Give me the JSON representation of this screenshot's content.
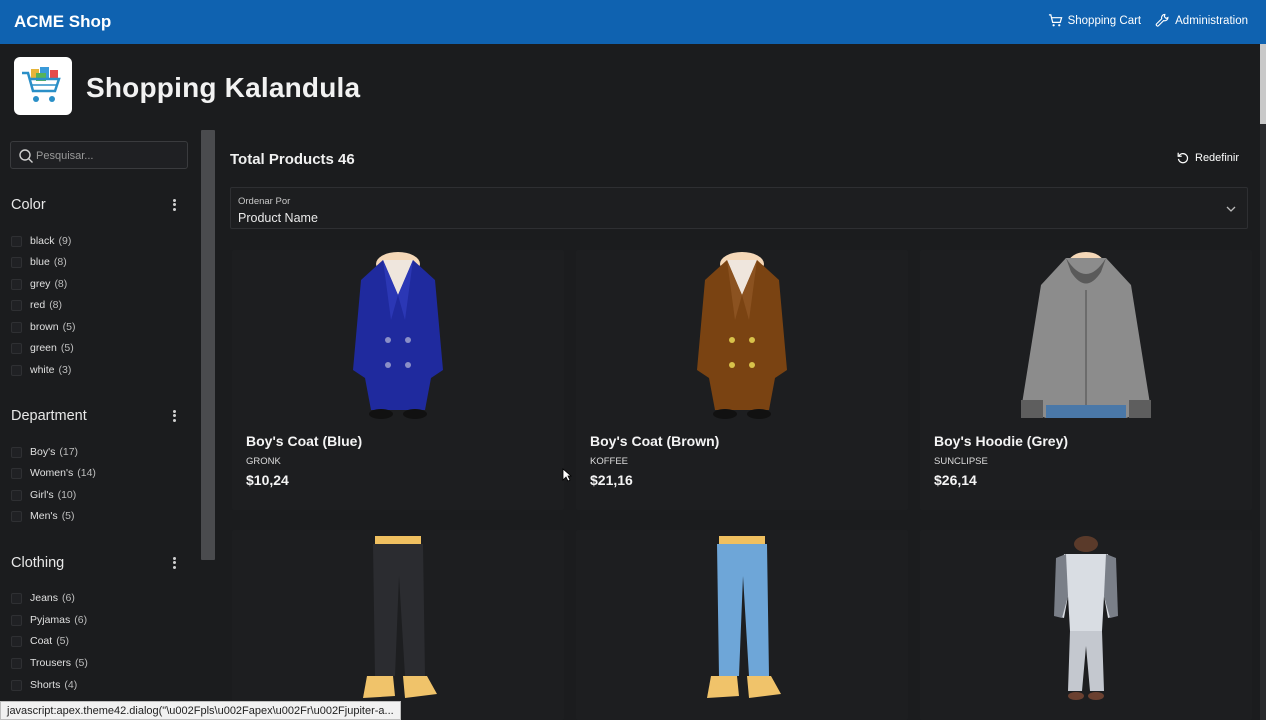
{
  "topbar": {
    "brand": "ACME Shop",
    "nav": [
      {
        "label": "Shopping Cart",
        "icon": "cart-icon"
      },
      {
        "label": "Administration",
        "icon": "wrench-icon"
      }
    ]
  },
  "header": {
    "title": "Shopping Kalandula",
    "logo_icon": "shopping-cart-logo-icon"
  },
  "sidebar": {
    "search_placeholder": "Pesquisar...",
    "facets": [
      {
        "title": "Color",
        "options": [
          {
            "label": "black",
            "count": "(9)"
          },
          {
            "label": "blue",
            "count": "(8)"
          },
          {
            "label": "grey",
            "count": "(8)"
          },
          {
            "label": "red",
            "count": "(8)"
          },
          {
            "label": "brown",
            "count": "(5)"
          },
          {
            "label": "green",
            "count": "(5)"
          },
          {
            "label": "white",
            "count": "(3)"
          }
        ]
      },
      {
        "title": "Department",
        "options": [
          {
            "label": "Boy's",
            "count": "(17)"
          },
          {
            "label": "Women's",
            "count": "(14)"
          },
          {
            "label": "Girl's",
            "count": "(10)"
          },
          {
            "label": "Men's",
            "count": "(5)"
          }
        ]
      },
      {
        "title": "Clothing",
        "options": [
          {
            "label": "Jeans",
            "count": "(6)"
          },
          {
            "label": "Pyjamas",
            "count": "(6)"
          },
          {
            "label": "Coat",
            "count": "(5)"
          },
          {
            "label": "Trousers",
            "count": "(5)"
          },
          {
            "label": "Shorts",
            "count": "(4)"
          }
        ]
      }
    ]
  },
  "main": {
    "total": "Total Products 46",
    "reset_label": "Redefinir",
    "sort": {
      "label": "Ordenar Por",
      "value": "Product Name"
    },
    "products": [
      {
        "name": "Boy's Coat (Blue)",
        "brand": "GRONK",
        "price": "$10,24",
        "color": "#1f2a9e"
      },
      {
        "name": "Boy's Coat (Brown)",
        "brand": "KOFFEE",
        "price": "$21,16",
        "color": "#7a4312"
      },
      {
        "name": "Boy's Hoodie (Grey)",
        "brand": "SUNCLIPSE",
        "price": "$26,14",
        "color": "#8c8c8c"
      },
      {
        "name": "",
        "brand": "",
        "price": "",
        "color": "#2b2c30"
      },
      {
        "name": "",
        "brand": "",
        "price": "",
        "color": "#6ea6d8"
      },
      {
        "name": "",
        "brand": "",
        "price": "",
        "color": "#d9dde3"
      }
    ]
  },
  "statusbar": {
    "text": "javascript:apex.theme42.dialog(\"\\u002Fpls\\u002Fapex\\u002Fr\\u002Fjupiter-a..."
  }
}
